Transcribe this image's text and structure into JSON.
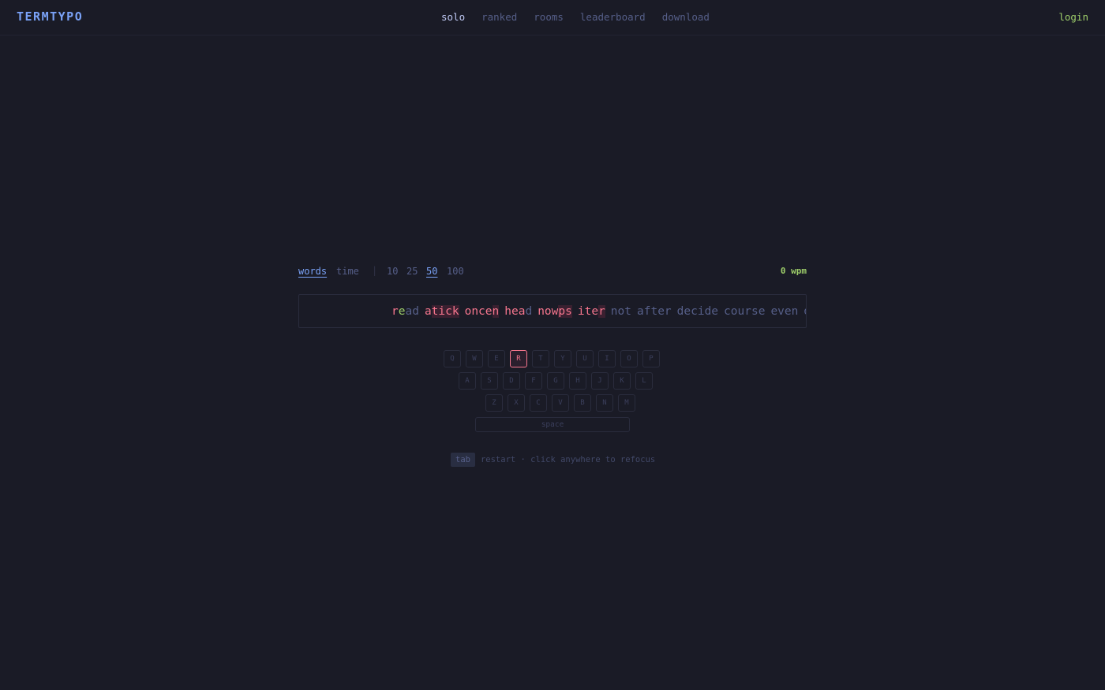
{
  "app": {
    "logo": "TERMTYPO"
  },
  "nav": {
    "items": [
      {
        "label": "solo",
        "active": true
      },
      {
        "label": "ranked",
        "active": false
      },
      {
        "label": "rooms",
        "active": false
      },
      {
        "label": "leaderboard",
        "active": false
      },
      {
        "label": "download",
        "active": false
      }
    ],
    "login": "login"
  },
  "modes": {
    "words": "words",
    "time": "time",
    "separator": "|",
    "counts": [
      "10",
      "25",
      "50",
      "100"
    ],
    "selected_mode": "words",
    "selected_count": "50"
  },
  "stats": {
    "wpm": "0 wpm"
  },
  "typing": {
    "words": [
      {
        "segments": [
          {
            "t": "r",
            "s": "ok"
          },
          {
            "t": "e",
            "s": "green"
          },
          {
            "t": "ad",
            "s": "dim"
          }
        ]
      },
      {
        "segments": [
          {
            "t": "a",
            "s": "ok"
          },
          {
            "t": "tick",
            "s": "err"
          }
        ]
      },
      {
        "segments": [
          {
            "t": "once",
            "s": "ok"
          },
          {
            "t": "n",
            "s": "err"
          }
        ]
      },
      {
        "segments": [
          {
            "t": "hea",
            "s": "ok"
          },
          {
            "t": "d",
            "s": "dim"
          }
        ]
      },
      {
        "segments": [
          {
            "t": "now",
            "s": "ok"
          },
          {
            "t": "ps",
            "s": "err"
          }
        ]
      },
      {
        "segments": [
          {
            "t": "ite",
            "s": "ok"
          },
          {
            "t": "r",
            "s": "err"
          }
        ]
      },
      {
        "segments": [
          {
            "t": "not",
            "s": "up"
          }
        ]
      },
      {
        "segments": [
          {
            "t": "after",
            "s": "up"
          }
        ]
      },
      {
        "segments": [
          {
            "t": "decide",
            "s": "up"
          }
        ]
      },
      {
        "segments": [
          {
            "t": "course",
            "s": "up"
          }
        ]
      },
      {
        "segments": [
          {
            "t": "even",
            "s": "up"
          }
        ]
      },
      {
        "segments": [
          {
            "t": "dry",
            "s": "up"
          }
        ]
      }
    ]
  },
  "keyboard": {
    "rows": [
      [
        "Q",
        "W",
        "E",
        "R",
        "T",
        "Y",
        "U",
        "I",
        "O",
        "P"
      ],
      [
        "A",
        "S",
        "D",
        "F",
        "G",
        "H",
        "J",
        "K",
        "L"
      ],
      [
        "Z",
        "X",
        "C",
        "V",
        "B",
        "N",
        "M"
      ]
    ],
    "highlight": "R",
    "space": "space"
  },
  "hint": {
    "key": "tab",
    "text": "restart · click anywhere to refocus"
  },
  "colors": {
    "background": "#1a1b26",
    "accent": "#7aa2f7",
    "error": "#f7768e",
    "success": "#9ece6a"
  }
}
